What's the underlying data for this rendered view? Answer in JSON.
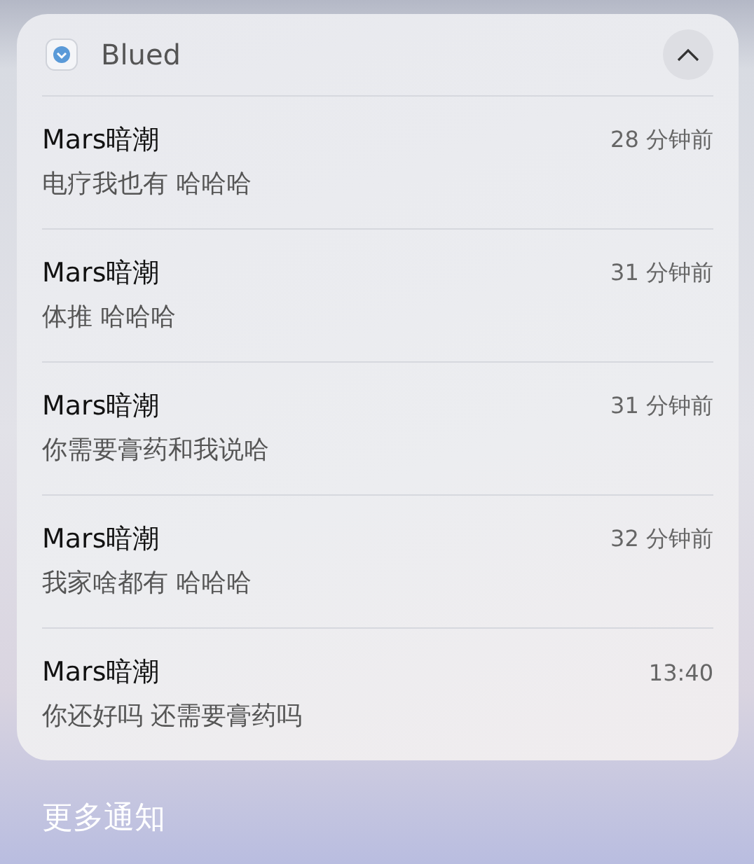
{
  "group": {
    "app_name": "Blued",
    "expanded": true,
    "notifications": [
      {
        "sender": "Mars暗潮",
        "time": "28 分钟前",
        "message": "电疗我也有 哈哈哈"
      },
      {
        "sender": "Mars暗潮",
        "time": "31 分钟前",
        "message": "体推 哈哈哈"
      },
      {
        "sender": "Mars暗潮",
        "time": "31 分钟前",
        "message": "你需要膏药和我说哈"
      },
      {
        "sender": "Mars暗潮",
        "time": "32 分钟前",
        "message": "我家啥都有 哈哈哈"
      },
      {
        "sender": "Mars暗潮",
        "time": "13:40",
        "message": "你还好吗 还需要膏药吗"
      }
    ]
  },
  "footer": {
    "more_label": "更多通知"
  }
}
